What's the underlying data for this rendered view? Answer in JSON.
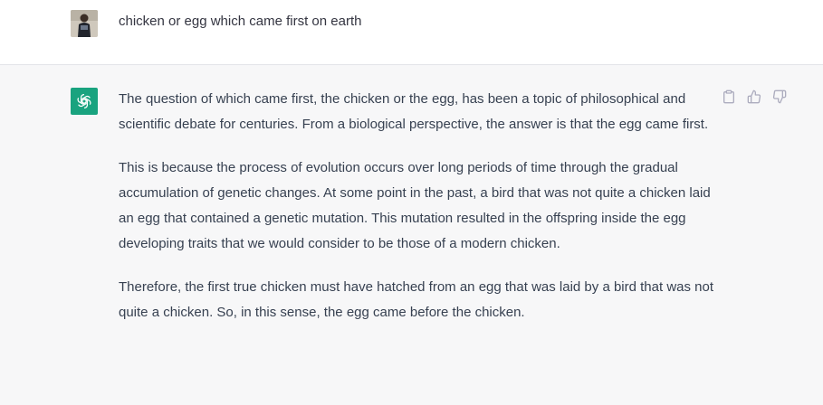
{
  "conversation": {
    "user_message": {
      "text": "chicken or egg which came first on earth"
    },
    "assistant_message": {
      "paragraphs": [
        "The question of which came first, the chicken or the egg, has been a topic of philosophical and scientific debate for centuries. From a biological perspective, the answer is that the egg came first.",
        "This is because the process of evolution occurs over long periods of time through the gradual accumulation of genetic changes. At some point in the past, a bird that was not quite a chicken laid an egg that contained a genetic mutation. This mutation resulted in the offspring inside the egg developing traits that we would consider to be those of a modern chicken.",
        "Therefore, the first true chicken must have hatched from an egg that was laid by a bird that was not quite a chicken. So, in this sense, the egg came before the chicken."
      ],
      "actions": [
        "clipboard-icon",
        "thumbs-up-icon",
        "thumbs-down-icon"
      ]
    }
  },
  "colors": {
    "assistant_bg": "#f7f7f8",
    "user_bg": "#ffffff",
    "bot_avatar": "#19a37f",
    "icon": "#acacbe"
  }
}
